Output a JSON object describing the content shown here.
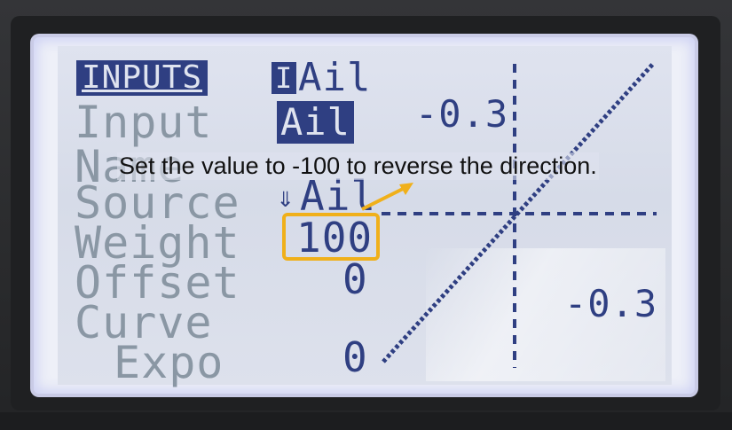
{
  "header": {
    "mode_tab": "INPUTS",
    "channel": "Ail"
  },
  "rows": [
    {
      "id": "input",
      "label": "Input",
      "value": "Ail"
    },
    {
      "id": "name",
      "label": "Name"
    },
    {
      "id": "source",
      "label": "Source",
      "value": "Ail"
    },
    {
      "id": "weight",
      "label": "Weight",
      "value": "100"
    },
    {
      "id": "offset",
      "label": "Offset",
      "value": "0"
    },
    {
      "id": "curve",
      "label": "Curve"
    },
    {
      "id": "expo",
      "label": "Expo",
      "value": "0"
    }
  ],
  "graph": {
    "top_value": "-0.3",
    "bottom_value": "-0.3"
  },
  "annotation": {
    "text": "Set the value to -100 to reverse the direction."
  },
  "colors": {
    "lcd_bg": "#dfe3ef",
    "pixel_dark": "#2f3f82",
    "pixel_dim": "#8a97a4",
    "highlight": "#f0b01a"
  }
}
